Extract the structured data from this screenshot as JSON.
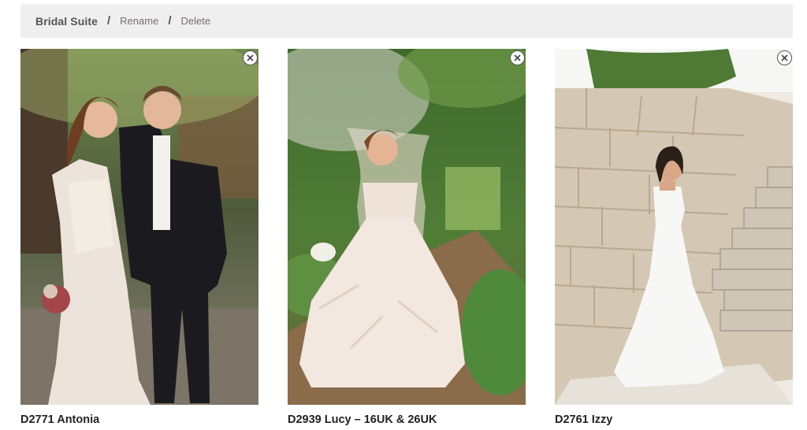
{
  "header": {
    "title": "Bridal Suite",
    "separator": "/",
    "rename_label": "Rename",
    "delete_label": "Delete"
  },
  "items": [
    {
      "name": "D2771 Antonia",
      "remove_icon": "close-icon"
    },
    {
      "name": "D2939 Lucy – 16UK & 26UK",
      "remove_icon": "close-icon"
    },
    {
      "name": "D2761 Izzy",
      "remove_icon": "close-icon"
    }
  ],
  "colors": {
    "header_bg": "#efefef",
    "link": "#7a6a70",
    "title": "#555555"
  }
}
